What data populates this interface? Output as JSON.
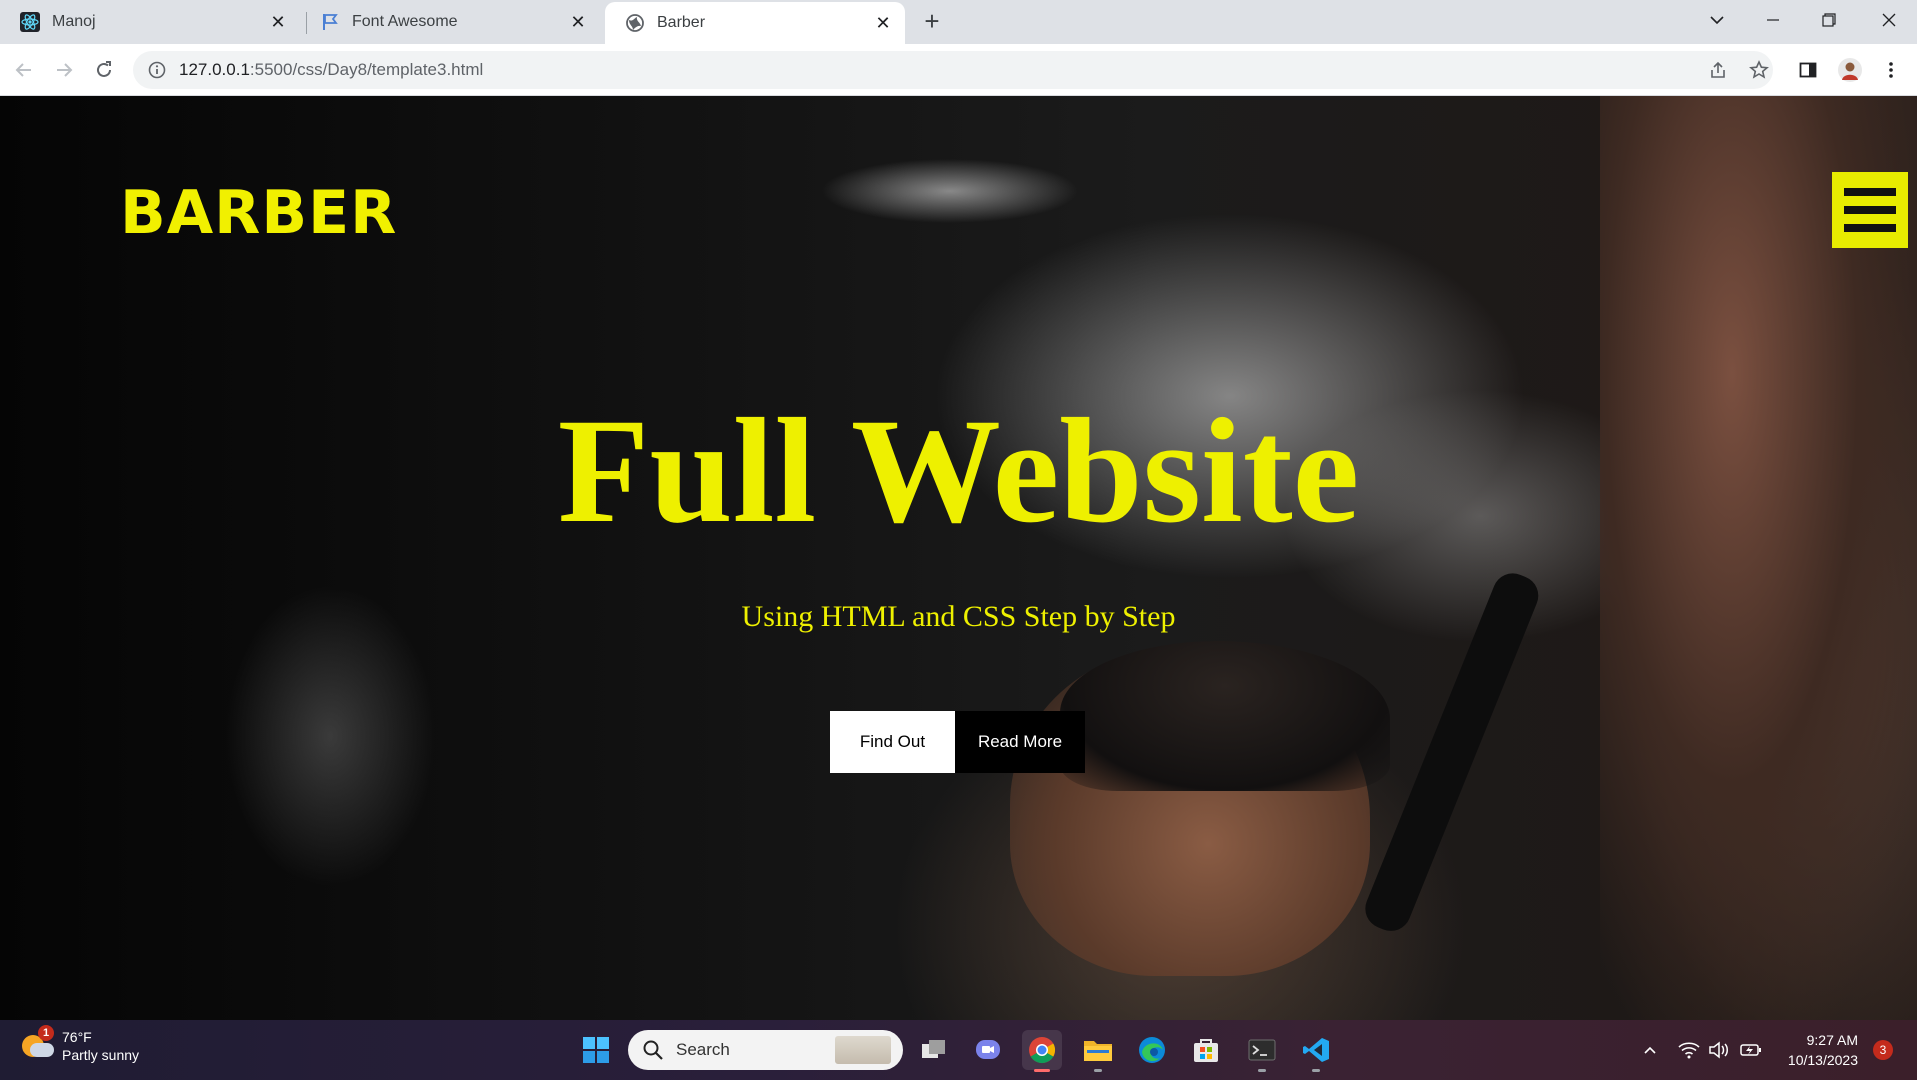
{
  "browser": {
    "tabs": [
      {
        "title": "Manoj",
        "icon": "react-icon",
        "active": false
      },
      {
        "title": "Font Awesome",
        "icon": "flag-icon",
        "active": false
      },
      {
        "title": "Barber",
        "icon": "globe-icon",
        "active": true
      }
    ],
    "url_host": "127.0.0.1",
    "url_path": ":5500/css/Day8/template3.html"
  },
  "site": {
    "logo": "BARBER",
    "hero_title": "Full Website",
    "hero_subtitle": "Using HTML and CSS Step by Step",
    "buttons": {
      "find_out": "Find Out",
      "read_more": "Read More"
    },
    "accent_color": "#eef000"
  },
  "taskbar": {
    "weather_temp": "76°F",
    "weather_desc": "Partly sunny",
    "weather_badge": "1",
    "search_placeholder": "Search",
    "time": "9:27 AM",
    "date": "10/13/2023",
    "notification_count": "3"
  }
}
